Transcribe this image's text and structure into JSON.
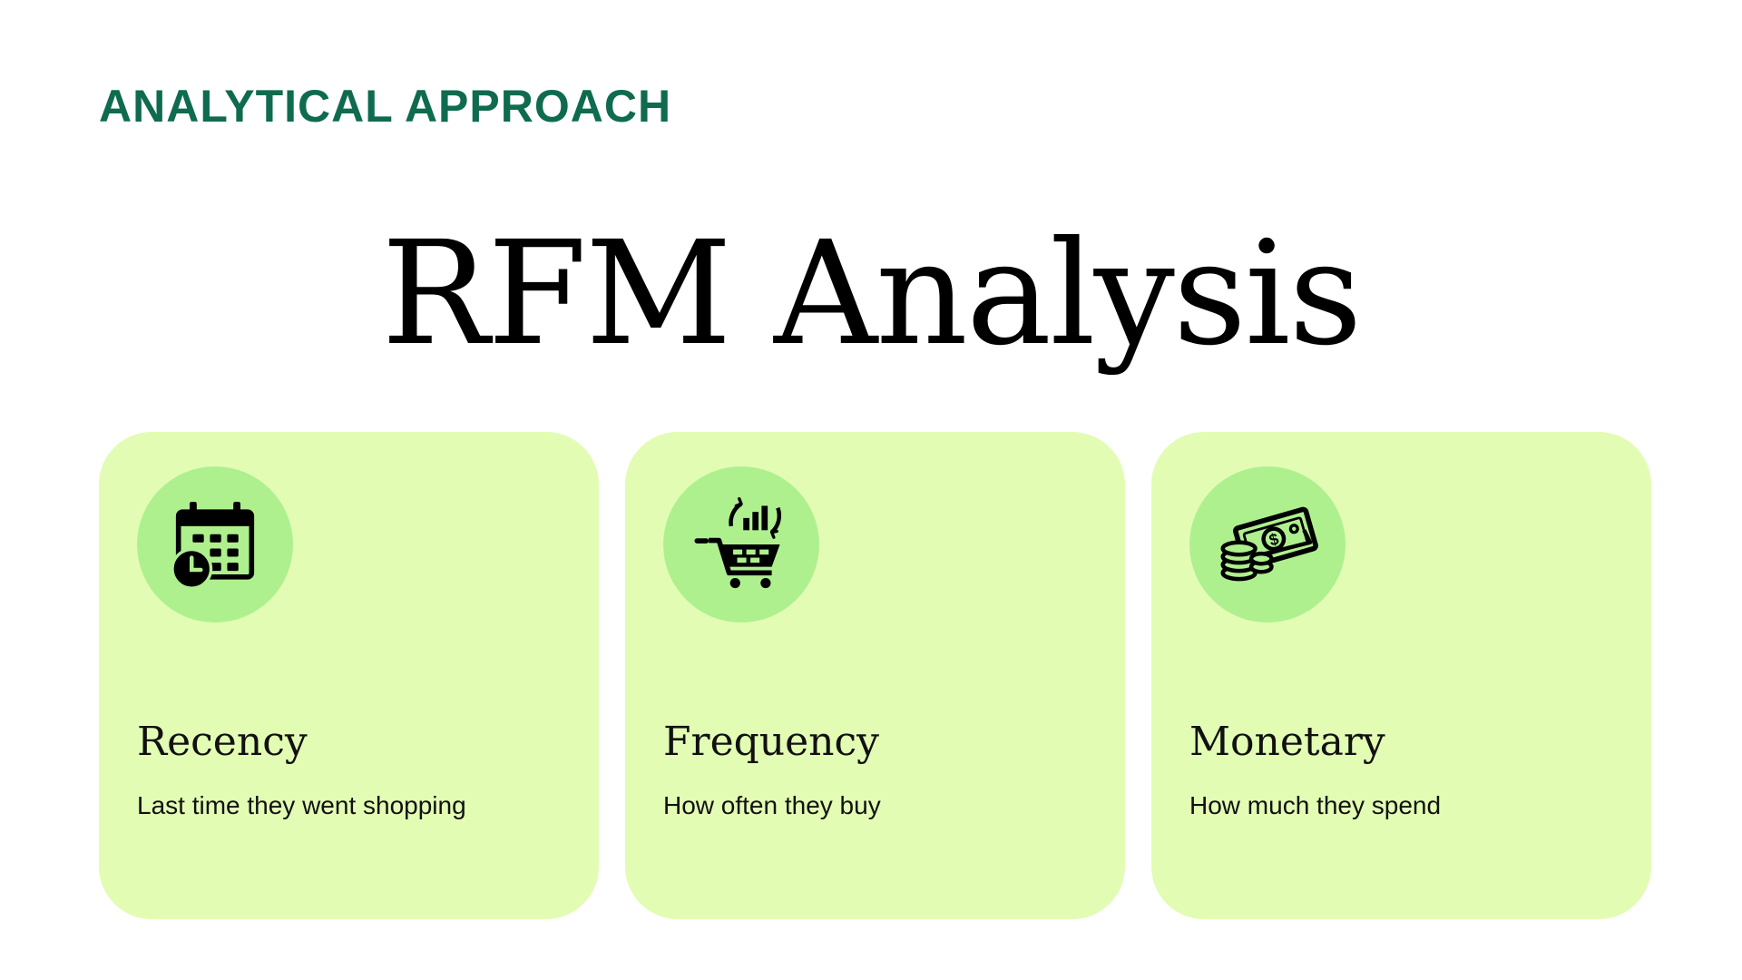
{
  "header": {
    "eyebrow": "ANALYTICAL APPROACH",
    "title": "RFM Analysis"
  },
  "colors": {
    "eyebrow": "#0f6b4f",
    "card_background": "#e3fcb4",
    "icon_circle": "#aef08e"
  },
  "cards": [
    {
      "icon": "calendar-clock-icon",
      "title": "Recency",
      "description": "Last time they went shopping"
    },
    {
      "icon": "shopping-cart-chart-icon",
      "title": "Frequency",
      "description": "How often they buy"
    },
    {
      "icon": "money-coins-icon",
      "title": "Monetary",
      "description": "How much they spend"
    }
  ]
}
